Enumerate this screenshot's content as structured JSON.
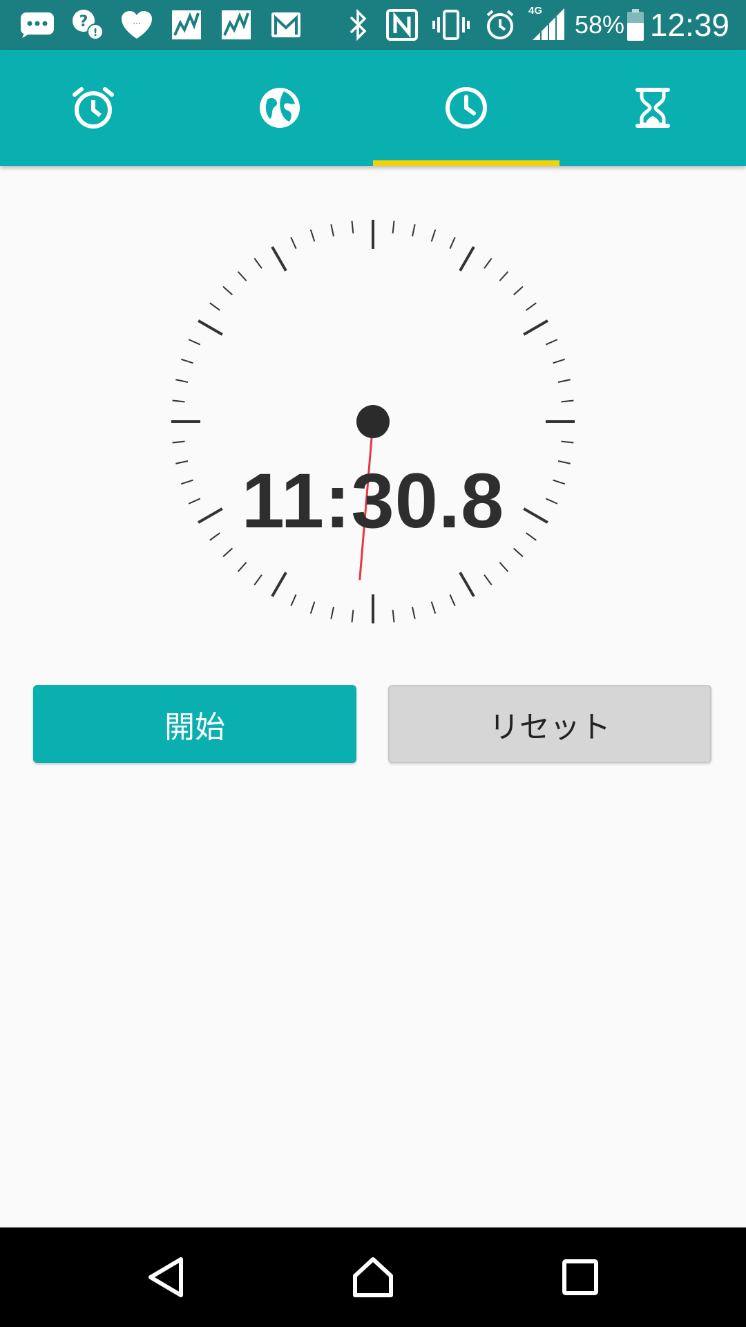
{
  "status_bar": {
    "battery_percent": "58%",
    "time": "12:39",
    "network_type": "4G",
    "icons": [
      "message-icon",
      "help-chat-icon",
      "app-heart-icon",
      "stock-chart-icon",
      "stock-chart-icon",
      "gmail-icon",
      "bluetooth-icon",
      "nfc-icon",
      "vibrate-icon",
      "alarm-status-icon",
      "signal-icon",
      "battery-icon"
    ]
  },
  "tabs": [
    {
      "name": "alarm",
      "icon": "alarm-clock-icon",
      "selected": false
    },
    {
      "name": "world-clock",
      "icon": "globe-icon",
      "selected": false
    },
    {
      "name": "stopwatch",
      "icon": "clock-icon",
      "selected": true
    },
    {
      "name": "timer",
      "icon": "hourglass-icon",
      "selected": false
    }
  ],
  "stopwatch": {
    "elapsed_display": "11:30.8",
    "hand_seconds": 30.8
  },
  "buttons": {
    "start_label": "開始",
    "reset_label": "リセット"
  },
  "nav_bar": {
    "icons": [
      "back-icon",
      "home-icon",
      "recents-icon"
    ]
  },
  "colors": {
    "status_bar": "#1b7f82",
    "accent": "#0aafaf",
    "tab_indicator": "#f2d30b",
    "second_hand": "#e53946",
    "background": "#fafafa",
    "reset_button": "#d6d6d6"
  }
}
